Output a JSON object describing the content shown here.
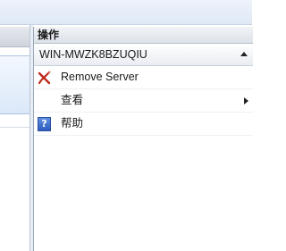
{
  "actions_pane": {
    "title": "操作",
    "section": {
      "name": "WIN-MWZK8BZUQIU",
      "items": [
        {
          "label": "Remove Server",
          "icon": "remove-x-icon"
        },
        {
          "label": "查看",
          "icon": "none",
          "has_submenu": true
        },
        {
          "label": "帮助",
          "icon": "help-icon"
        }
      ]
    }
  },
  "help_icon_glyph": "?"
}
